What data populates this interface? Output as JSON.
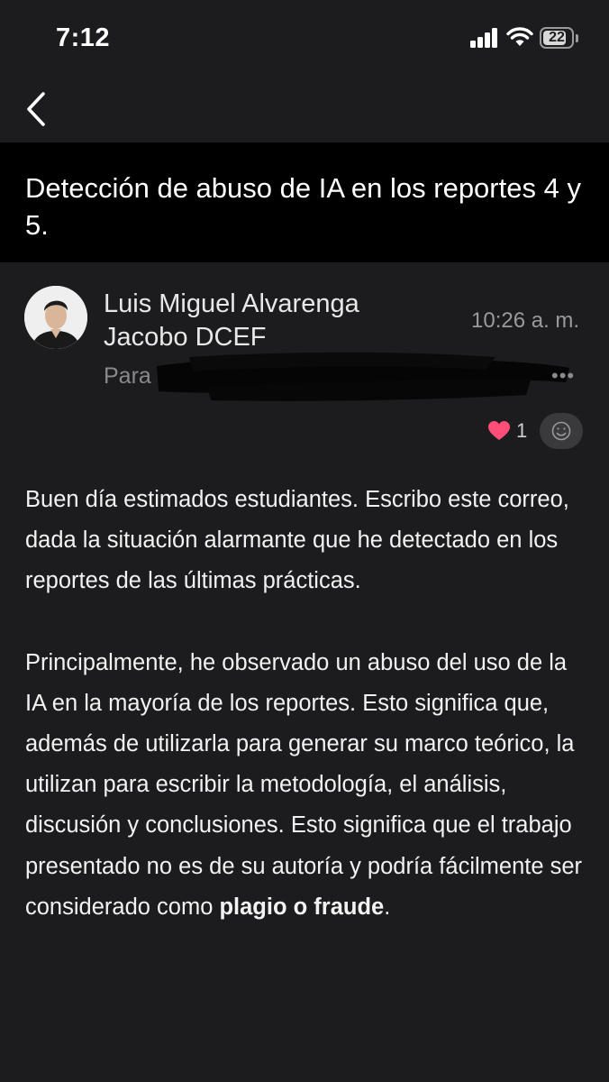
{
  "status_bar": {
    "time": "7:12",
    "battery_level": "22"
  },
  "email": {
    "subject": "Detección de abuso de IA en los reportes 4 y 5.",
    "sender": "Luis Miguel Alvarenga Jacobo DCEF",
    "timestamp": "10:26 a. m.",
    "to_label": "Para",
    "reaction": {
      "icon": "heart-icon",
      "color": "#ff4f78",
      "count": "1"
    },
    "body": {
      "p1": "Buen día estimados estudiantes. Escribo este correo, dada la situación alarmante que he detectado en los reportes de las últimas prácticas.",
      "p2_text": "Principalmente, he observado un abuso del uso de la IA en la mayoría de los reportes. Esto significa que, además de utilizarla para generar su marco teórico, la utilizan para escribir la metodología, el análisis, discusión y conclusiones.  Esto significa que el trabajo presentado no es de su autoría y podría fácilmente ser considerado como ",
      "p2_bold": "plagio o fraude",
      "p2_end": "."
    }
  },
  "colors": {
    "background": "#1c1c1e",
    "subject_bar": "#000000",
    "secondary_text": "#9a9a9a"
  }
}
